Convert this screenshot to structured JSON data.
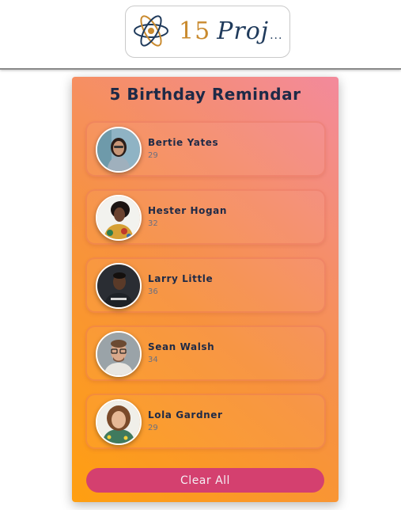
{
  "header": {
    "logo_number": "15",
    "logo_word": "Proj",
    "logo_dots": "...",
    "logo_icon": "atom-icon"
  },
  "card": {
    "title": "5 Birthday Remindar",
    "gradient_colors": [
      "#ff9f10",
      "#f7923f",
      "#f38a9c"
    ],
    "people": [
      {
        "name": "Bertie Yates",
        "age": "29",
        "avatar": "avatar-photo"
      },
      {
        "name": "Hester Hogan",
        "age": "32",
        "avatar": "avatar-photo"
      },
      {
        "name": "Larry Little",
        "age": "36",
        "avatar": "avatar-photo"
      },
      {
        "name": "Sean Walsh",
        "age": "34",
        "avatar": "avatar-photo"
      },
      {
        "name": "Lola Gardner",
        "age": "29",
        "avatar": "avatar-photo"
      }
    ],
    "clear_label": "Clear All",
    "clear_color": "#d4406f"
  }
}
